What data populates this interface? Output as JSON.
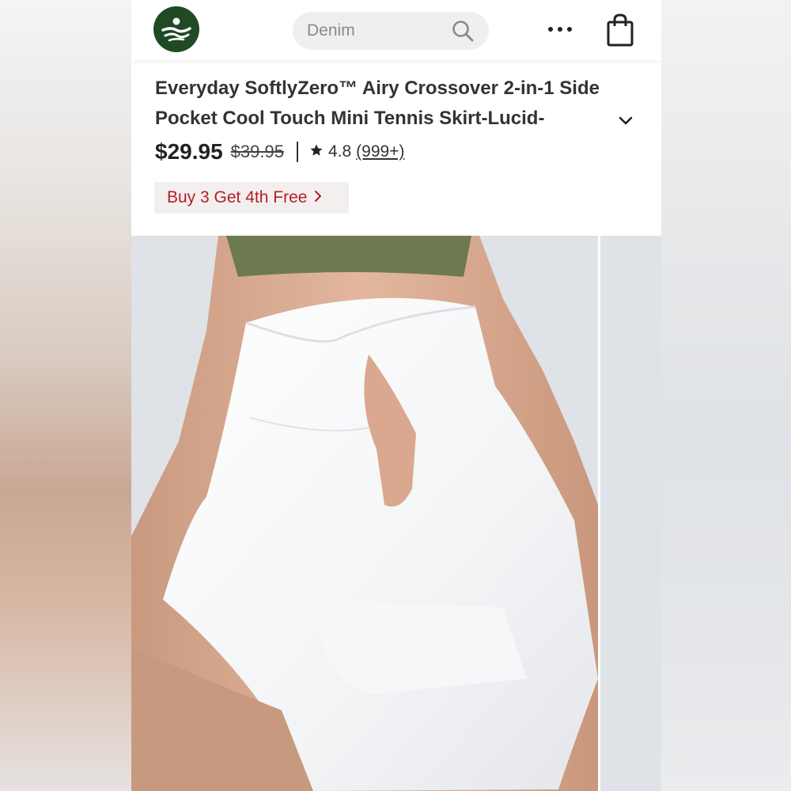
{
  "header": {
    "search_placeholder": "Denim"
  },
  "product": {
    "title": "Everyday SoftlyZero™ Airy Crossover 2-in-1 Side Pocket Cool Touch Mini Tennis Skirt-Lucid-",
    "price": "$29.95",
    "original_price": "$39.95",
    "rating": "4.8",
    "review_count": "(999+)",
    "promo": "Buy 3 Get 4th Free"
  },
  "icons": {
    "logo": "brand-logo-icon",
    "search": "search-icon",
    "more": "more-dots-icon",
    "bag": "shopping-bag-icon",
    "expand": "chevron-down-icon",
    "star": "star-icon",
    "promo_arrow": "chevron-right-icon"
  },
  "colors": {
    "brand_green": "#1f4a24",
    "promo_red": "#b21f2a",
    "promo_bg": "#f4efef"
  }
}
